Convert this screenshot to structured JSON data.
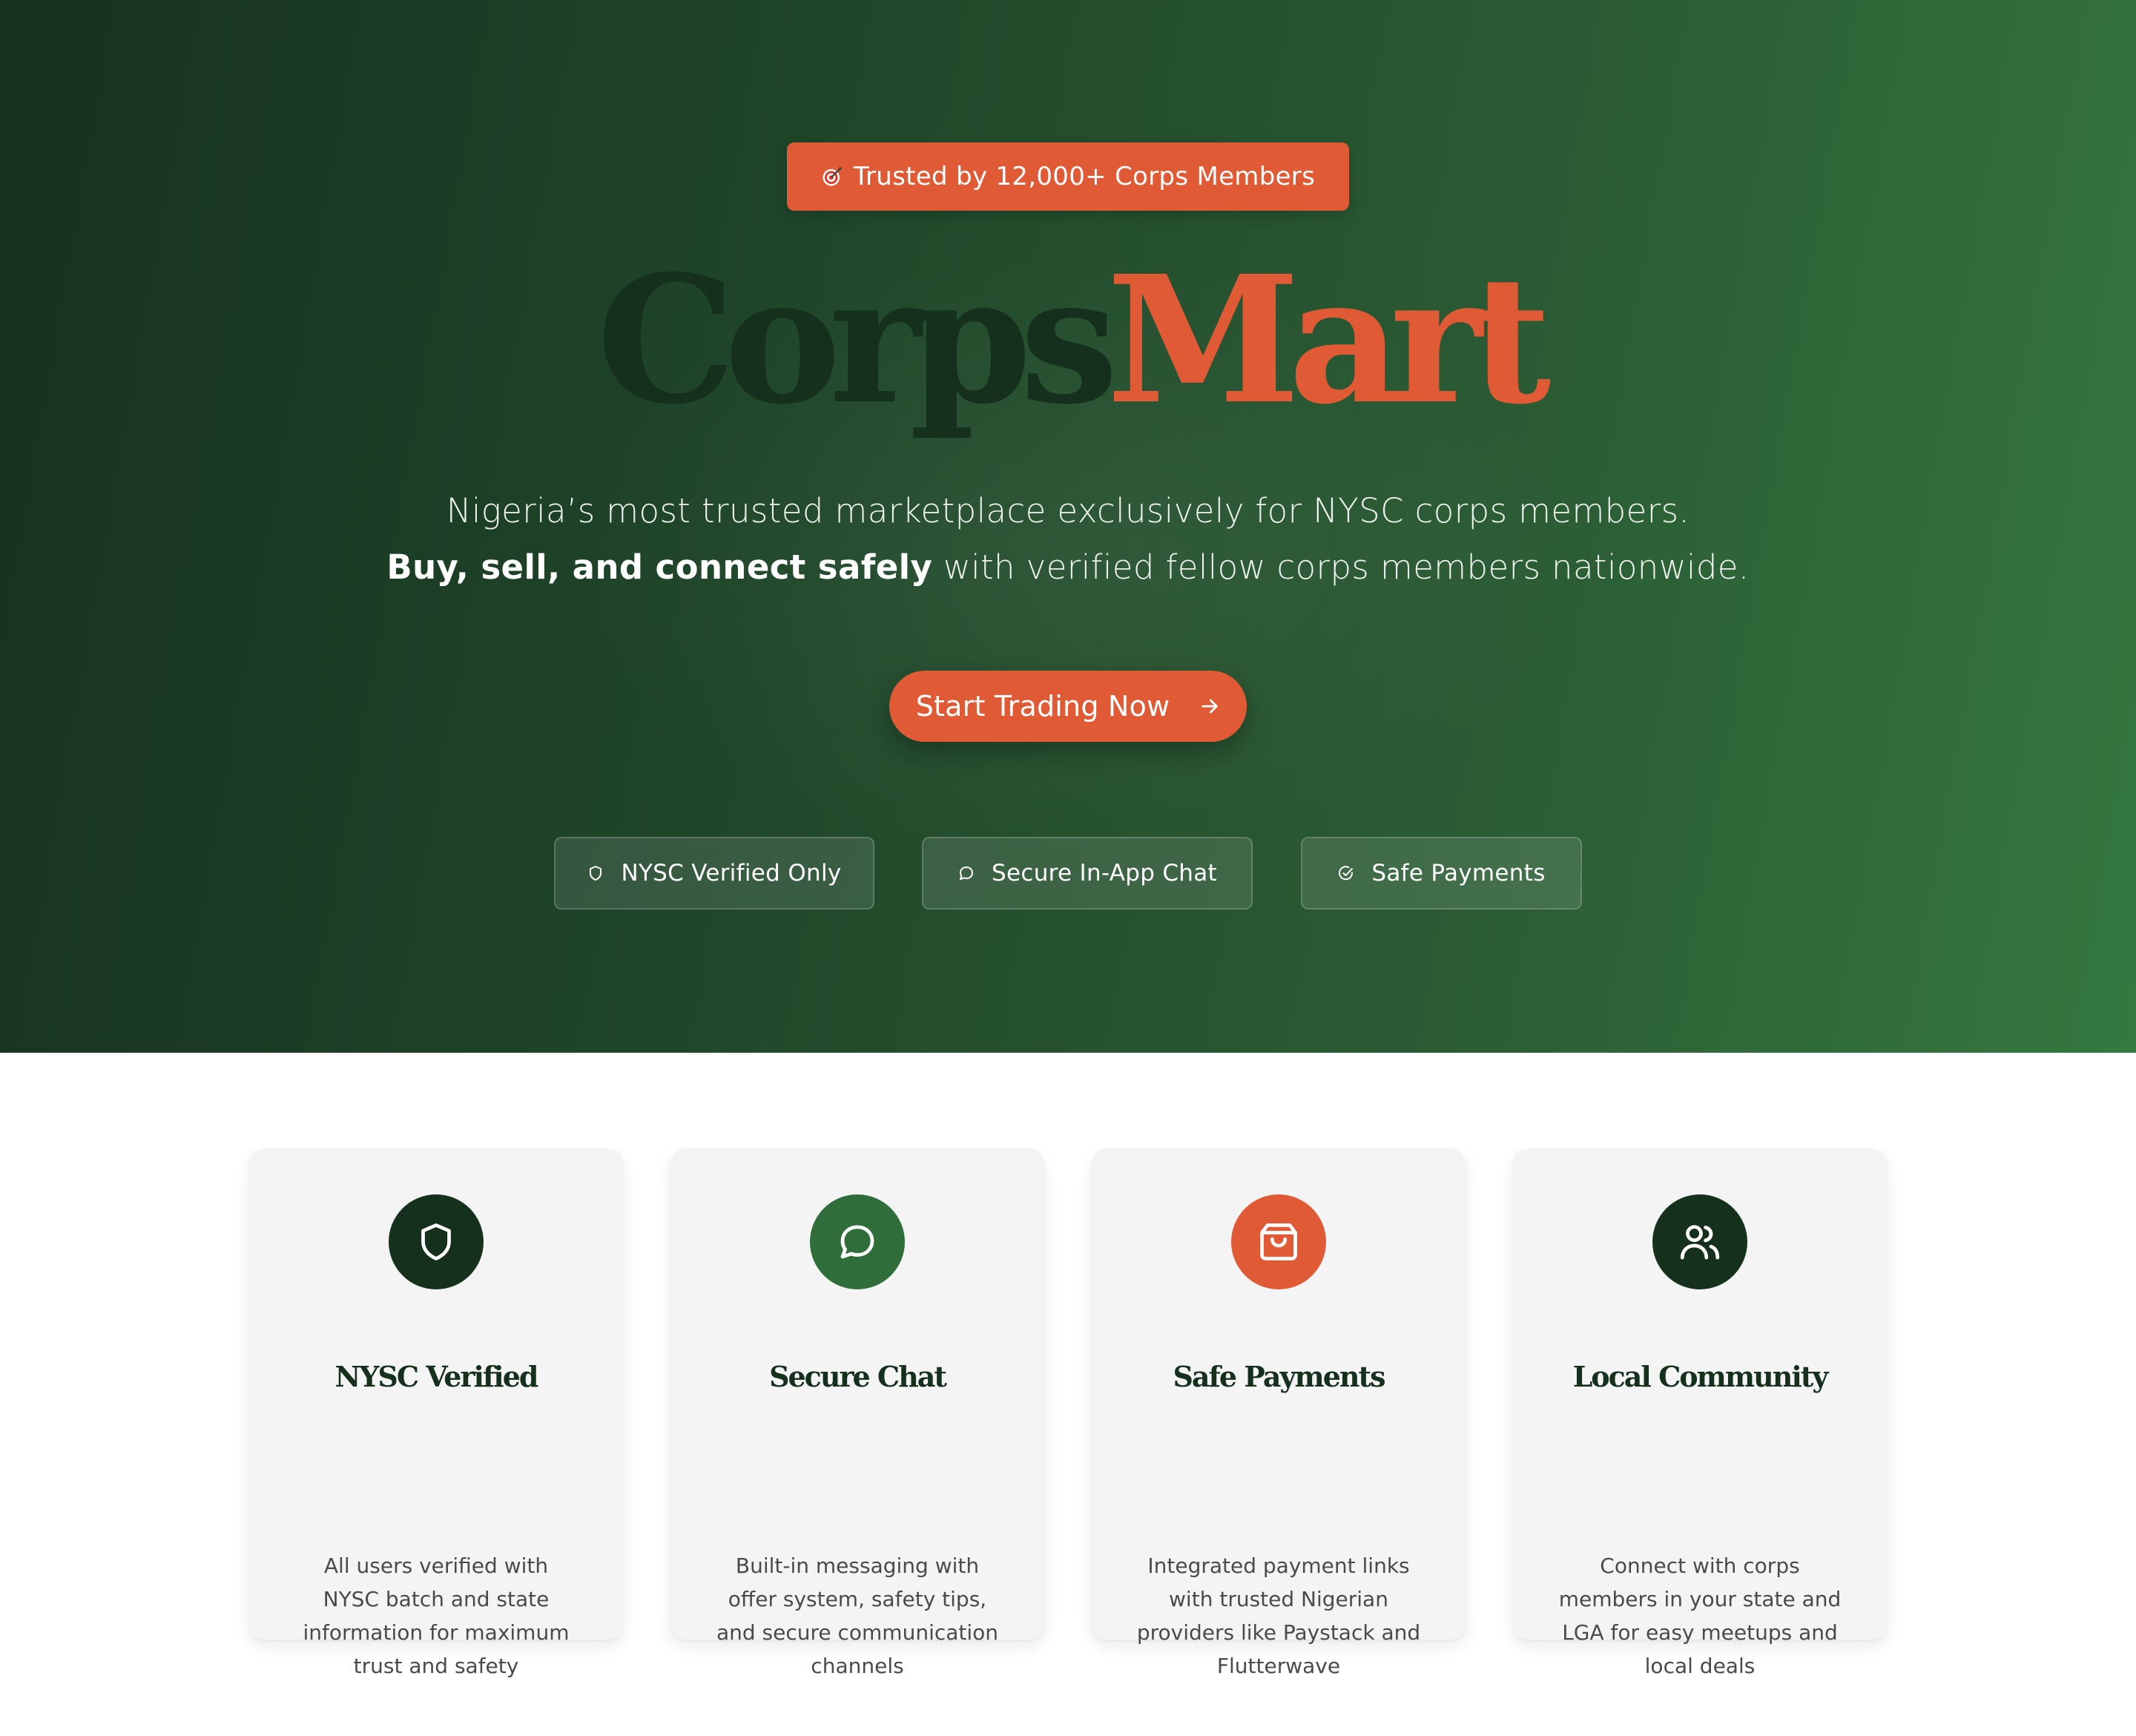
{
  "hero": {
    "badge": {
      "icon": "target-icon",
      "text": "Trusted by 12,000+ Corps Members"
    },
    "brand": {
      "part1": "Corps",
      "part2": "Mart"
    },
    "tagline_line1": "Nigeria’s most trusted marketplace exclusively for NYSC corps members.",
    "tagline_line2_bold": "Buy, sell, and connect safely",
    "tagline_line2_rest": " with verified fellow corps members nationwide.",
    "cta": {
      "label": "Start Trading Now",
      "icon": "arrow-right-icon"
    },
    "pills": [
      {
        "icon": "shield-icon",
        "label": "NYSC Verified Only"
      },
      {
        "icon": "chat-bubble-icon",
        "label": "Secure In-App Chat"
      },
      {
        "icon": "check-circle-icon",
        "label": "Safe Payments"
      }
    ]
  },
  "features": [
    {
      "icon": "shield-icon",
      "icon_bg": "#15301c",
      "title": "NYSC Verified",
      "description": "All users verified with NYSC batch and state information for maximum trust and safety"
    },
    {
      "icon": "chat-bubble-icon",
      "icon_bg": "#2f6e3a",
      "title": "Secure Chat",
      "description": "Built-in messaging with offer system, safety tips, and secure communication channels"
    },
    {
      "icon": "shopping-bag-icon",
      "icon_bg": "#e05a36",
      "title": "Safe Payments",
      "description": "Integrated payment links with trusted Nigerian providers like Paystack and Flutterwave"
    },
    {
      "icon": "users-icon",
      "icon_bg": "#15301c",
      "title": "Local Community",
      "description": "Connect with corps members in your state and LGA for easy meetups and local deals"
    }
  ],
  "colors": {
    "brand_dark": "#15301c",
    "accent": "#e05a36",
    "hero_start": "#17321f",
    "hero_end": "#357840",
    "card_bg": "#f4f4f4"
  }
}
